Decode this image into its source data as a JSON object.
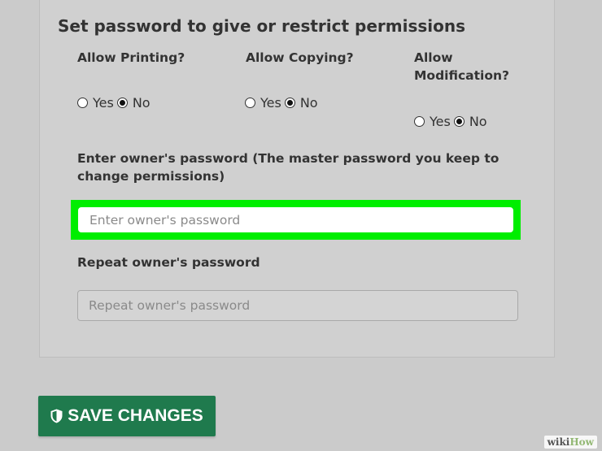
{
  "section": {
    "title": "Set password to give or restrict permissions"
  },
  "permissions": [
    {
      "label": "Allow Printing?",
      "yes": "Yes",
      "no": "No",
      "selected": "No"
    },
    {
      "label": "Allow Copying?",
      "yes": "Yes",
      "no": "No",
      "selected": "No"
    },
    {
      "label_line1": "Allow",
      "label_line2": "Modification?",
      "yes": "Yes",
      "no": "No",
      "selected": "No"
    }
  ],
  "owner_password": {
    "label": "Enter owner's password (The master password you keep to change permissions)",
    "placeholder": "Enter owner's password",
    "value": "",
    "highlight_color": "#00ee00"
  },
  "repeat_password": {
    "label": "Repeat owner's password",
    "placeholder": "Repeat owner's password",
    "value": ""
  },
  "save_button": {
    "label": "SAVE CHANGES",
    "icon": "shield-icon",
    "color": "#1f7a4d"
  },
  "watermark": {
    "part1": "wiki",
    "part2": "How"
  }
}
